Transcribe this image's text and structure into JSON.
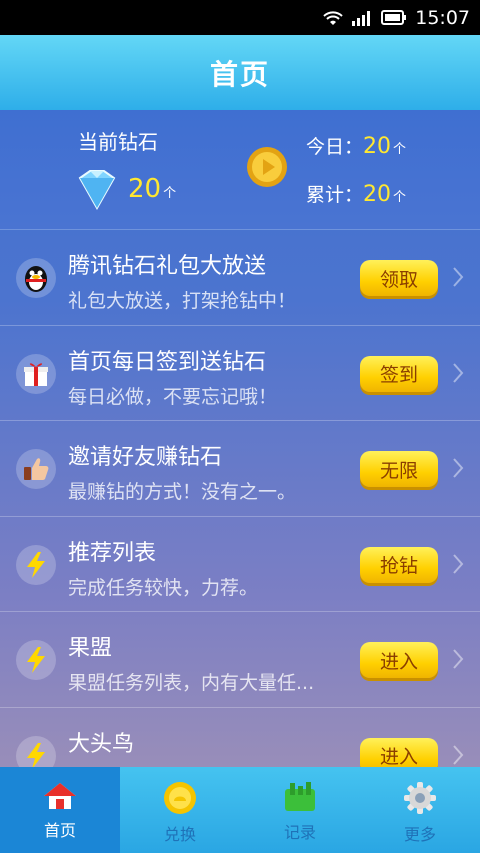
{
  "status_bar": {
    "time": "15:07"
  },
  "header": {
    "title": "首页"
  },
  "summary": {
    "current_label": "当前钻石",
    "current_value": "20",
    "unit": "个",
    "today_label": "今日：",
    "today_value": "20",
    "total_label": "累计：",
    "total_value": "20"
  },
  "tasks": [
    {
      "title": "腾讯钻石礼包大放送",
      "subtitle": "礼包大放送，打架抢钻中！",
      "button": "领取",
      "icon": "qq-penguin-icon"
    },
    {
      "title": "首页每日签到送钻石",
      "subtitle": "每日必做，不要忘记哦！",
      "button": "签到",
      "icon": "gift-icon"
    },
    {
      "title": "邀请好友赚钻石",
      "subtitle": "最赚钻的方式！没有之一。",
      "button": "无限",
      "icon": "thumbs-up-icon"
    },
    {
      "title": "推荐列表",
      "subtitle": "完成任务较快，力荐。",
      "button": "抢钻",
      "icon": "lightning-icon"
    },
    {
      "title": "果盟",
      "subtitle": "果盟任务列表，内有大量任...",
      "button": "进入",
      "icon": "lightning-icon"
    },
    {
      "title": "大头鸟",
      "subtitle": "",
      "button": "进入",
      "icon": "lightning-icon"
    }
  ],
  "nav": [
    {
      "label": "首页",
      "icon": "home-icon",
      "active": true
    },
    {
      "label": "兑换",
      "icon": "exchange-icon",
      "active": false
    },
    {
      "label": "记录",
      "icon": "record-icon",
      "active": false
    },
    {
      "label": "更多",
      "icon": "gear-icon",
      "active": false
    }
  ],
  "colors": {
    "accent_yellow": "#ffe830",
    "title_bar": "#2eaee9",
    "button": "#ffd000"
  }
}
